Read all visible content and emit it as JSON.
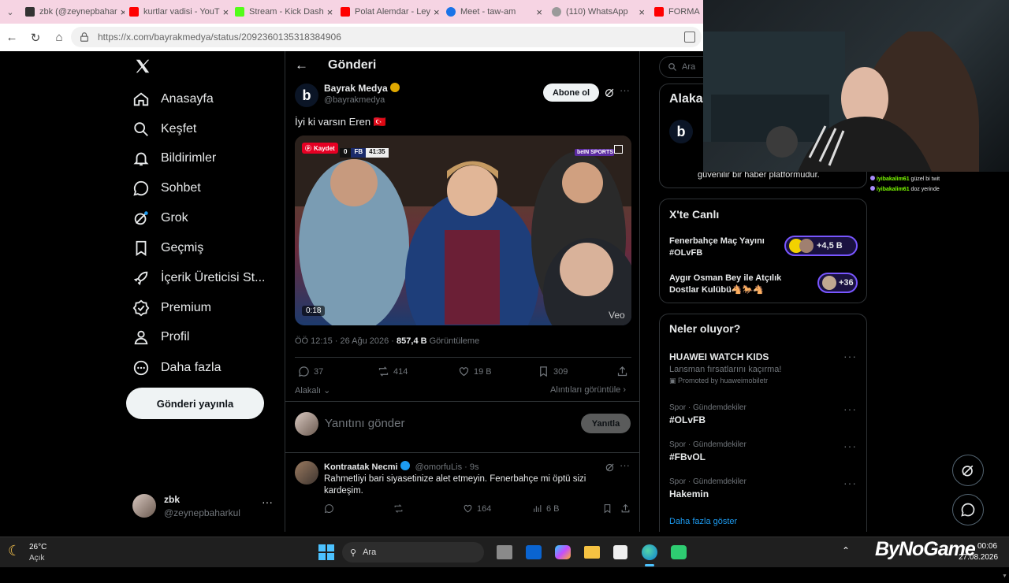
{
  "browser": {
    "tabs": [
      {
        "label": "zbk (@zeynepbahar",
        "color": "#333333"
      },
      {
        "label": "kurtlar vadisi - YouT",
        "color": "#ff0000"
      },
      {
        "label": "Stream - Kick Dash",
        "color": "#53fc18"
      },
      {
        "label": "Polat Alemdar - Ley",
        "color": "#ff0000"
      },
      {
        "label": "Meet - taw-am",
        "color": "#1a73e8"
      },
      {
        "label": "(110) WhatsApp",
        "color": "#25d366"
      },
      {
        "label": "FORMA",
        "color": "#ff0000"
      }
    ],
    "url": "https://x.com/bayrakmedya/status/2092360135318384906"
  },
  "nav": {
    "items": [
      {
        "label": "Anasayfa",
        "icon": "home-icon"
      },
      {
        "label": "Keşfet",
        "icon": "search-icon"
      },
      {
        "label": "Bildirimler",
        "icon": "bell-icon"
      },
      {
        "label": "Sohbet",
        "icon": "chat-icon"
      },
      {
        "label": "Grok",
        "icon": "grok-icon"
      },
      {
        "label": "Geçmiş",
        "icon": "bookmark-icon"
      },
      {
        "label": "İçerik Üreticisi St...",
        "icon": "rocket-icon"
      },
      {
        "label": "Premium",
        "icon": "verified-icon"
      },
      {
        "label": "Profil",
        "icon": "person-icon"
      },
      {
        "label": "Daha fazla",
        "icon": "more-icon"
      }
    ],
    "post_button": "Gönderi yayınla",
    "account_name": "zbk",
    "account_handle": "@zeynepbaharkul"
  },
  "post": {
    "header_title": "Gönderi",
    "author_name": "Bayrak Medya",
    "author_handle": "@bayrakmedya",
    "subscribe": "Abone ol",
    "text": "İyi ki varsın Eren 🇹🇷",
    "video": {
      "save_label": "Kaydet",
      "score_left": "0",
      "score_team": "FB",
      "score_time": "41:35",
      "channel": "beIN SPORTS",
      "duration": "0:18",
      "watermark": "Veo"
    },
    "meta_time": "ÖÖ 12:15 · 26 Ağu 2026 · ",
    "views": "857,4 B",
    "views_label": " Görüntüleme",
    "replies": "37",
    "reposts": "414",
    "likes": "19 B",
    "bookmarks": "309",
    "relevant": "Alakalı",
    "quotes": "Alıntıları görüntüle",
    "reply_placeholder": "Yanıtını gönder",
    "reply_button": "Yanıtla"
  },
  "reply": {
    "author_name": "Kontraatak Necmi",
    "author_handle": "@omorfuLis · 9s",
    "text": "Rahmetliyi bari siyasetinize alet etmeyin. Fenerbahçe mi öptü sizi kardeşim.",
    "likes": "164",
    "views": "6 B"
  },
  "right": {
    "search_placeholder": "Ara",
    "relevant_title": "Alaka",
    "relevant_bio_tail": "güvenilir bir haber platformudur.",
    "live_title": "X'te Canlı",
    "live": [
      {
        "title": "Fenerbahçe Maç Yayını #OLvFB",
        "count": "+4,5 B"
      },
      {
        "title": "Aygır Osman Bey ile Atçılık Dostlar Kulübü🐴🐎🐴",
        "count": "+36"
      }
    ],
    "happening_title": "Neler oluyor?",
    "ad": {
      "name": "HUAWEI WATCH KIDS",
      "desc": "Lansman fırsatlarını kaçırma!",
      "promo": "Promoted by huaweimobiletr"
    },
    "trends": [
      {
        "cat": "Spor · Gündemdekiler",
        "name": "#OLvFB"
      },
      {
        "cat": "Spor · Gündemdekiler",
        "name": "#FBvOL"
      },
      {
        "cat": "Spor · Gündemdekiler",
        "name": "Hakemin"
      }
    ],
    "show_more": "Daha fazla göster"
  },
  "chat": [
    {
      "user": "iyibakalim61",
      "msg": "güzel bi twit"
    },
    {
      "user": "iyibakalim61",
      "msg": "doz yerinde"
    }
  ],
  "taskbar": {
    "weather_temp": "26°C",
    "weather_desc": "Açık",
    "search": "Ara",
    "brand": "ByNoGame",
    "time": "00:06",
    "date": "27.08.2026"
  }
}
